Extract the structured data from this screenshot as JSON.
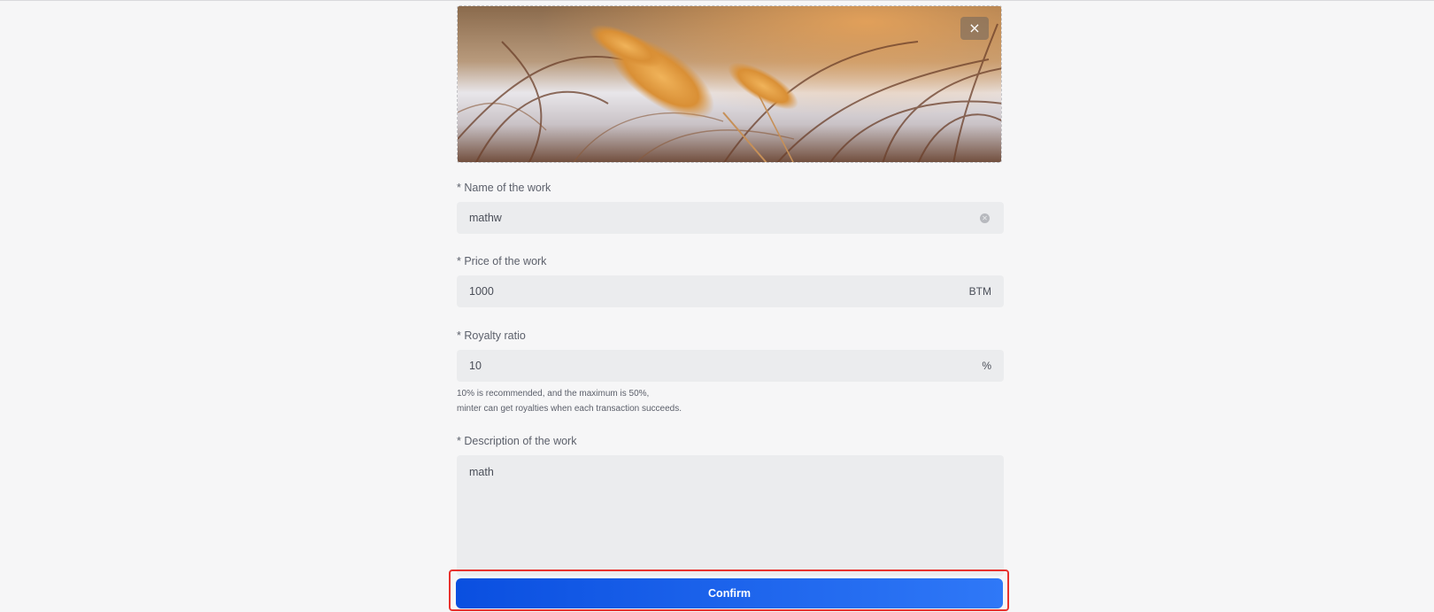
{
  "cover": {
    "image_alt": "Golden pampas grass against a blurred background",
    "close_label": "×"
  },
  "name": {
    "label": "* Name of the work",
    "value": "mathw",
    "clear_icon": "clear-circle-icon"
  },
  "price": {
    "label": "* Price of the work",
    "value": "1000",
    "suffix": "BTM"
  },
  "royalty": {
    "label": "* Royalty ratio",
    "value": "10",
    "suffix": "%",
    "hint_line1": "10% is recommended, and the maximum is 50%,",
    "hint_line2": "minter can get royalties when each transaction succeeds."
  },
  "description": {
    "label": "* Description of the work",
    "value": "math"
  },
  "confirm": {
    "label": "Confirm"
  },
  "colors": {
    "accent_start": "#0a4fe0",
    "accent_end": "#2f78f7",
    "highlight_border": "#e8322e",
    "field_bg": "#ebecee"
  }
}
